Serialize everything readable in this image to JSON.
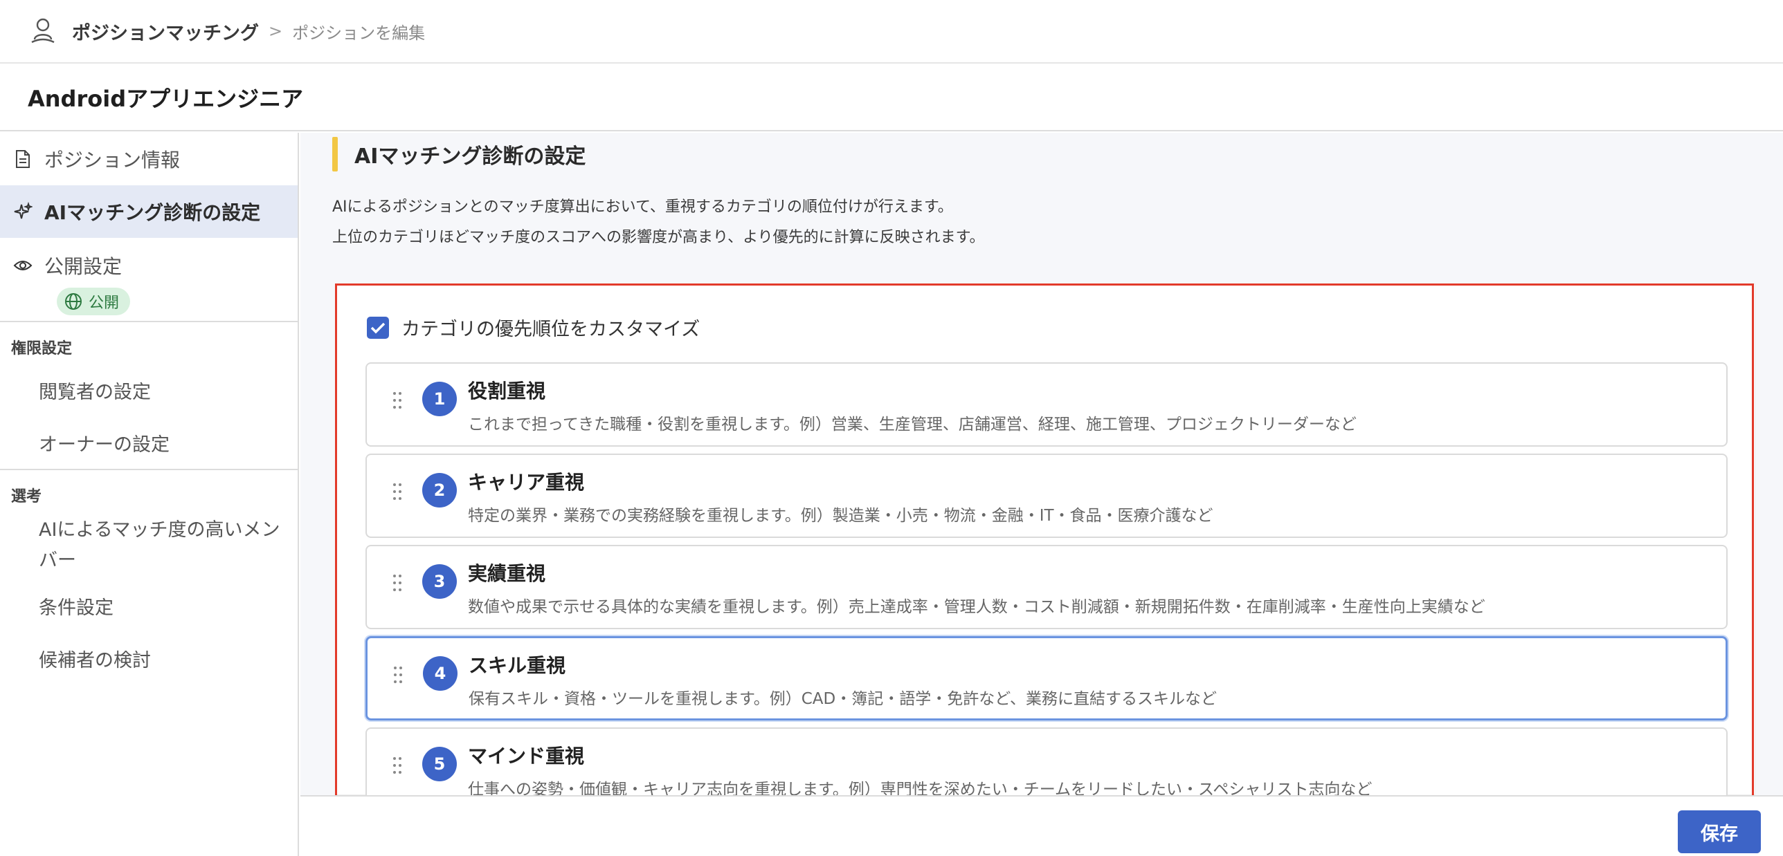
{
  "topbar": {
    "app_title": "ポジションマッチング",
    "separator": ">",
    "breadcrumb": "ポジションを編集"
  },
  "position": {
    "title": "Androidアプリエンジニア"
  },
  "sidebar": {
    "items": [
      {
        "label": "ポジション情報",
        "icon": "document-icon"
      },
      {
        "label": "AIマッチング診断の設定",
        "icon": "sparkle-icon"
      },
      {
        "label": "公開設定",
        "icon": "eye-icon",
        "badge": "公開"
      }
    ],
    "permissions": {
      "label": "権限設定",
      "items": [
        "閲覧者の設定",
        "オーナーの設定"
      ]
    },
    "selection": {
      "label": "選考",
      "items": [
        "AIによるマッチ度の高いメンバー",
        "条件設定",
        "候補者の検討"
      ]
    }
  },
  "main": {
    "section_title": "AIマッチング診断の設定",
    "desc_line1": "AIによるポジションとのマッチ度算出において、重視するカテゴリの順位付けが行えます。",
    "desc_line2": "上位のカテゴリほどマッチ度のスコアへの影響度が高まり、より優先的に計算に反映されます。",
    "customize_label": "カテゴリの優先順位をカスタマイズ",
    "customize_checked": true,
    "categories": [
      {
        "num": "1",
        "title": "役割重視",
        "desc": "これまで担ってきた職種・役割を重視します。例）営業、生産管理、店舗運営、経理、施工管理、プロジェクトリーダーなど"
      },
      {
        "num": "2",
        "title": "キャリア重視",
        "desc": "特定の業界・業務での実務経験を重視します。例）製造業・小売・物流・金融・IT・食品・医療介護など"
      },
      {
        "num": "3",
        "title": "実績重視",
        "desc": "数値や成果で示せる具体的な実績を重視します。例）売上達成率・管理人数・コスト削減額・新規開拓件数・在庫削減率・生産性向上実績など"
      },
      {
        "num": "4",
        "title": "スキル重視",
        "desc": "保有スキル・資格・ツールを重視します。例）CAD・簿記・語学・免許など、業務に直結するスキルなど"
      },
      {
        "num": "5",
        "title": "マインド重視",
        "desc": "仕事への姿勢・価値観・キャリア志向を重視します。例）専門性を深めたい・チームをリードしたい・スペシャリスト志向など"
      }
    ]
  },
  "footer": {
    "save_label": "保存"
  },
  "colors": {
    "accent": "#3d64c7",
    "highlight_border": "#e23a2a",
    "section_bar": "#f2c744",
    "badge_bg": "#d9f1df"
  }
}
